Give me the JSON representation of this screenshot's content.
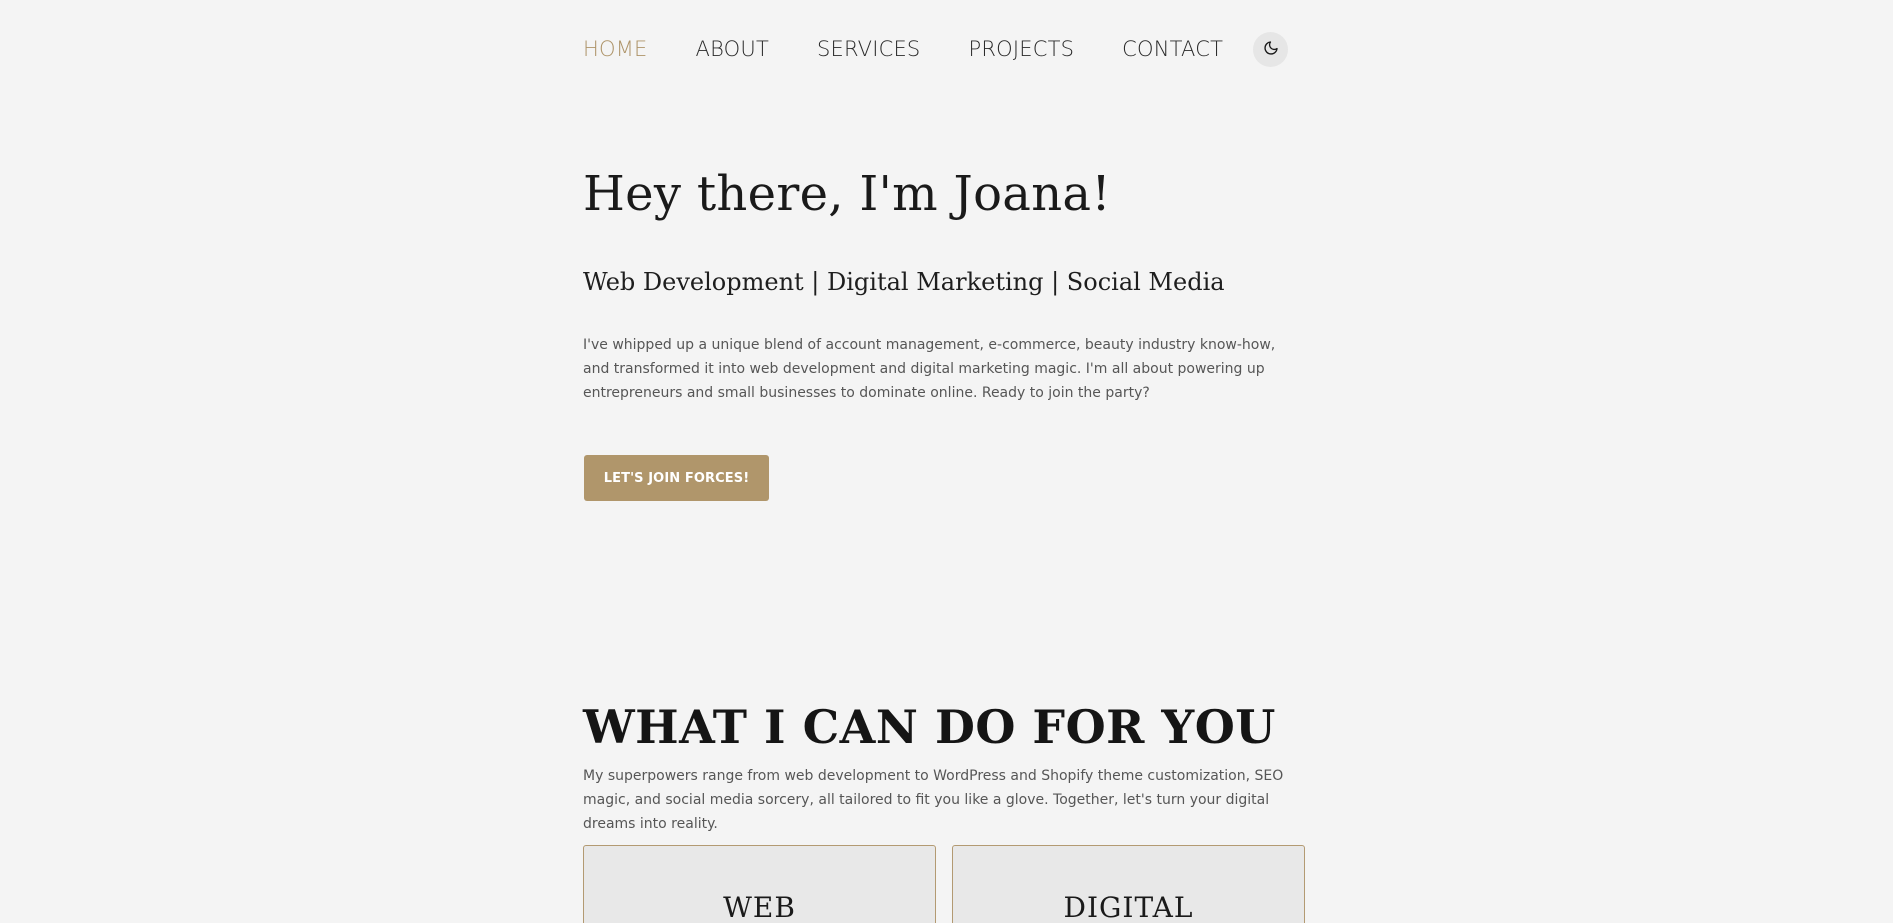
{
  "nav": {
    "items": [
      {
        "label": "HOME",
        "active": true
      },
      {
        "label": "ABOUT",
        "active": false
      },
      {
        "label": "SERVICES",
        "active": false
      },
      {
        "label": "PROJECTS",
        "active": false
      },
      {
        "label": "CONTACT",
        "active": false
      }
    ],
    "theme_toggle_icon": "moon-icon"
  },
  "hero": {
    "title": "Hey there, I'm Joana!",
    "subtitle": "Web Development | Digital Marketing | Social Media",
    "text": "I've whipped up a unique blend of account management, e-commerce, beauty industry know-how, and transformed it into web development and digital marketing magic. I'm all about powering up entrepreneurs and small businesses to dominate online. Ready to join the party?",
    "cta_label": "LET'S JOIN FORCES!"
  },
  "services": {
    "title": "WHAT I CAN DO FOR YOU",
    "text": "My superpowers range from web development to WordPress and Shopify theme customization, SEO magic, and social media sorcery, all tailored to fit you like a glove. Together, let's turn your digital dreams into reality.",
    "cards": [
      {
        "title": "WEB"
      },
      {
        "title": "DIGITAL"
      }
    ]
  },
  "colors": {
    "accent": "#b0966b",
    "background": "#f4f4f4",
    "card_background": "#e8e8e8",
    "text": "#1c1c1c"
  }
}
